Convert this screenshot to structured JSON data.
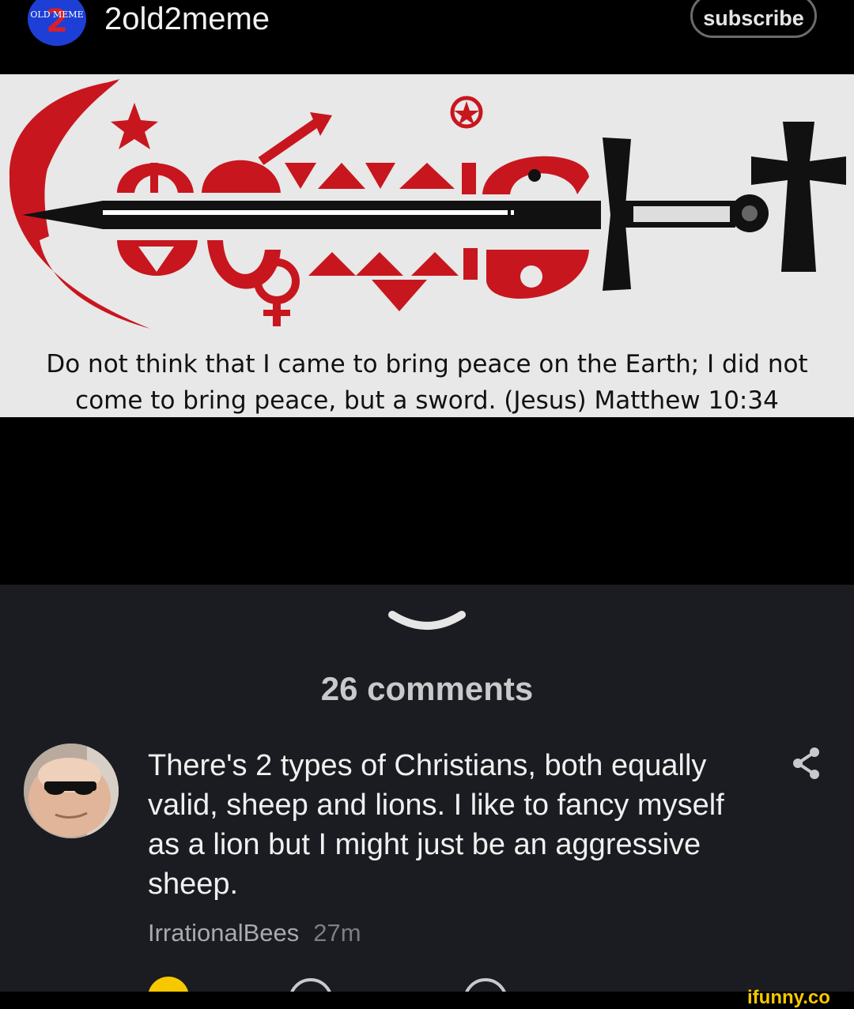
{
  "header": {
    "channel_name": "2old2meme",
    "subscribe_label": "subscribe",
    "avatar_text": "OLD MEME"
  },
  "meme": {
    "caption_line1": "Do not think that I came to bring peace on the Earth; I did not",
    "caption_line2": "come to bring peace, but a sword. (Jesus) Matthew 10:34"
  },
  "comments": {
    "count_label": "26 comments",
    "items": [
      {
        "text": "There's 2 types of Christians, both equally valid, sheep and lions. I like to fancy myself as a lion but I might just be an aggressive sheep.",
        "author": "IrrationalBees",
        "time": "27m"
      }
    ]
  },
  "watermark": "ifunny.co",
  "colors": {
    "panel_bg": "#1b1c21",
    "symbol_red": "#c8161e",
    "accent_yellow": "#f7c800"
  }
}
